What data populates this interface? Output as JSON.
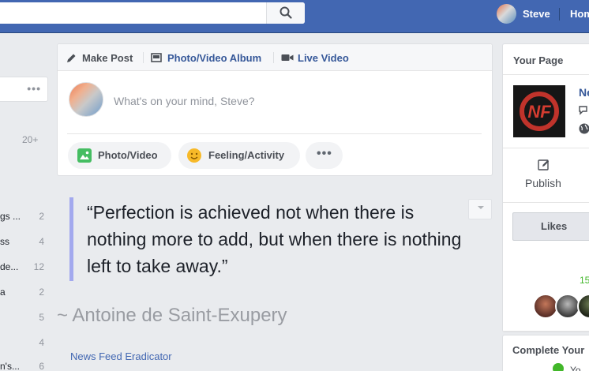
{
  "topbar": {
    "user_name": "Steve",
    "home_label": "Home"
  },
  "left_sidebar": {
    "top_count": "20+",
    "items": [
      {
        "label": "gs ...",
        "count": "2"
      },
      {
        "label": "ss",
        "count": "4"
      },
      {
        "label": "de...",
        "count": "12"
      },
      {
        "label": "a",
        "count": "2"
      },
      {
        "label": "",
        "count": "5"
      },
      {
        "label": "",
        "count": "4"
      },
      {
        "label": "n's...",
        "count": "6"
      }
    ]
  },
  "composer": {
    "tabs": [
      {
        "label": "Make Post"
      },
      {
        "label": "Photo/Video Album"
      },
      {
        "label": "Live Video"
      }
    ],
    "placeholder": "What's on your mind, Steve?",
    "actions": [
      {
        "label": "Photo/Video"
      },
      {
        "label": "Feeling/Activity"
      }
    ]
  },
  "quote": {
    "text": "“Perfection is achieved not when there is nothing more to add, but when there is nothing left to take away.”",
    "author": "~ Antoine de Saint-Exupery",
    "footer_link": "News Feed Eradicator"
  },
  "right_column": {
    "your_page_title": "Your Page",
    "page_name": "Ne",
    "publish_label": "Publish",
    "likes_label": "Likes",
    "likes_count": "15",
    "complete_title": "Complete Your",
    "complete_item": "Yo"
  },
  "colors": {
    "brand_blue": "#4267b2",
    "quote_bar": "#a3a9ee",
    "green": "#42b72a"
  }
}
